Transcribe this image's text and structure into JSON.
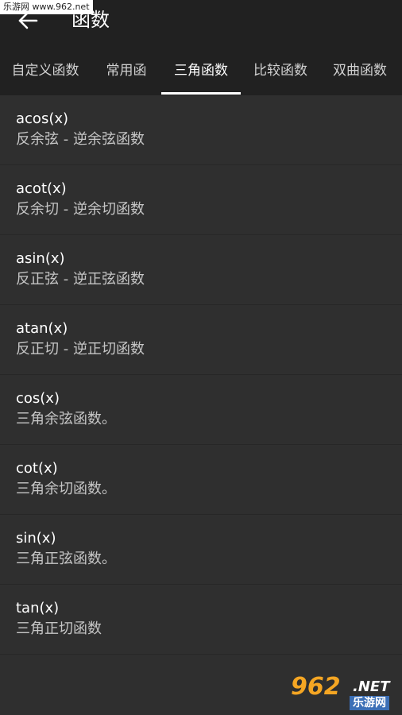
{
  "watermark_top": "乐游网 www.962.net",
  "appbar": {
    "title": "函数"
  },
  "tabs": [
    {
      "label": "自定义函数",
      "active": false
    },
    {
      "label": "常用函",
      "active": false
    },
    {
      "label": "三角函数",
      "active": true
    },
    {
      "label": "比较函数",
      "active": false
    },
    {
      "label": "双曲函数",
      "active": false
    }
  ],
  "items": [
    {
      "title": "acos(x)",
      "desc": "反余弦 - 逆余弦函数"
    },
    {
      "title": "acot(x)",
      "desc": "反余切 - 逆余切函数"
    },
    {
      "title": "asin(x)",
      "desc": "反正弦 - 逆正弦函数"
    },
    {
      "title": "atan(x)",
      "desc": "反正切 - 逆正切函数"
    },
    {
      "title": "cos(x)",
      "desc": "三角余弦函数。"
    },
    {
      "title": "cot(x)",
      "desc": "三角余切函数。"
    },
    {
      "title": "sin(x)",
      "desc": "三角正弦函数。"
    },
    {
      "title": "tan(x)",
      "desc": "三角正切函数"
    }
  ],
  "watermark_logo": {
    "num": "962",
    "net": ".NET",
    "cn": "乐游网"
  },
  "colors": {
    "appbar": "#212121",
    "background": "#2f2f2f",
    "indicator": "#ffffff"
  }
}
